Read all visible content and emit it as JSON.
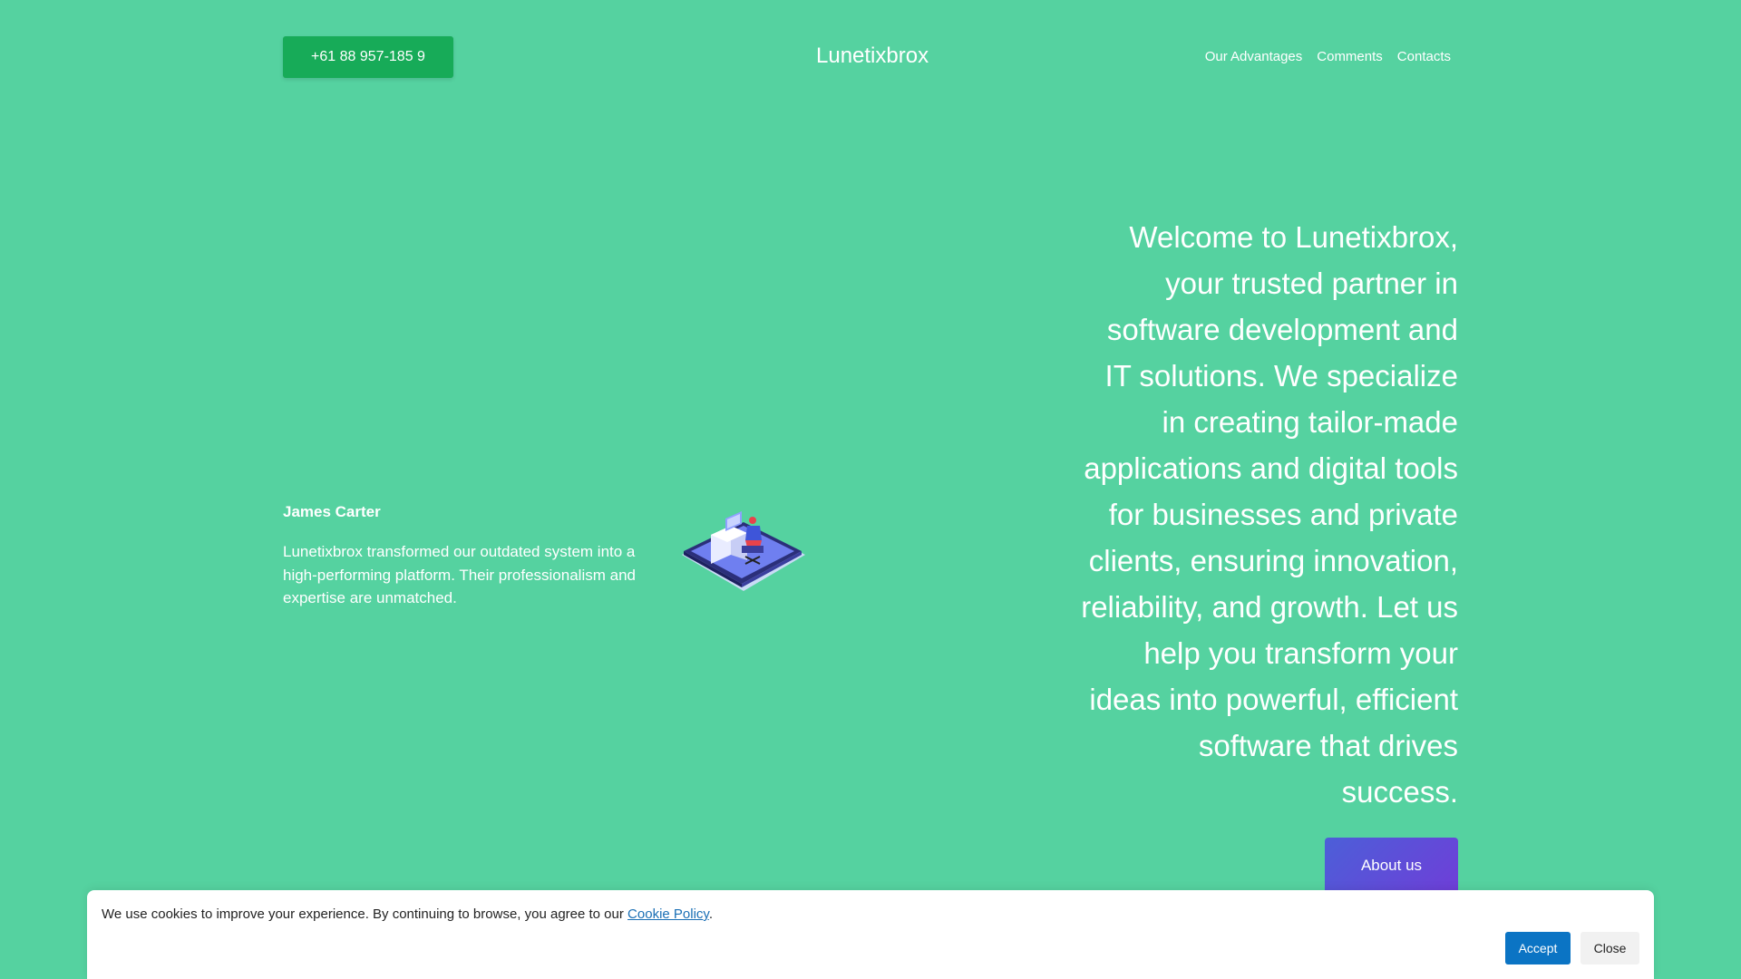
{
  "header": {
    "phone_label": "+61 88 957-185 9",
    "brand": "Lunetixbrox",
    "nav": [
      {
        "label": "Our Advantages"
      },
      {
        "label": "Comments"
      },
      {
        "label": "Contacts"
      }
    ]
  },
  "testimonial": {
    "name": "James Carter",
    "text": "Lunetixbrox transformed our outdated system into a high-performing platform. Their professionalism and expertise are unmatched.",
    "illustration_icon": "workstation-illustration-icon"
  },
  "hero": {
    "text": "Welcome to Lunetixbrox, your trusted partner in software development and IT solutions. We specialize in creating tailor-made applications and digital tools for businesses and private clients, ensuring innovation, reliability, and growth. Let us help you transform your ideas into powerful, efficient software that drives success.",
    "button_label": "About us"
  },
  "cookie": {
    "text": "We use cookies to improve your experience. By continuing to browse, you agree to our ",
    "link_label": "Cookie Policy",
    "suffix": ".",
    "accept_label": "Accept",
    "close_label": "Close"
  },
  "colors": {
    "background": "#55d2a0",
    "phone_button": "#17ab58",
    "about_button_start": "#4c5fd8",
    "about_button_end": "#6f3ed8",
    "accept_button": "#0b74c4",
    "link": "#1a6fb5"
  }
}
